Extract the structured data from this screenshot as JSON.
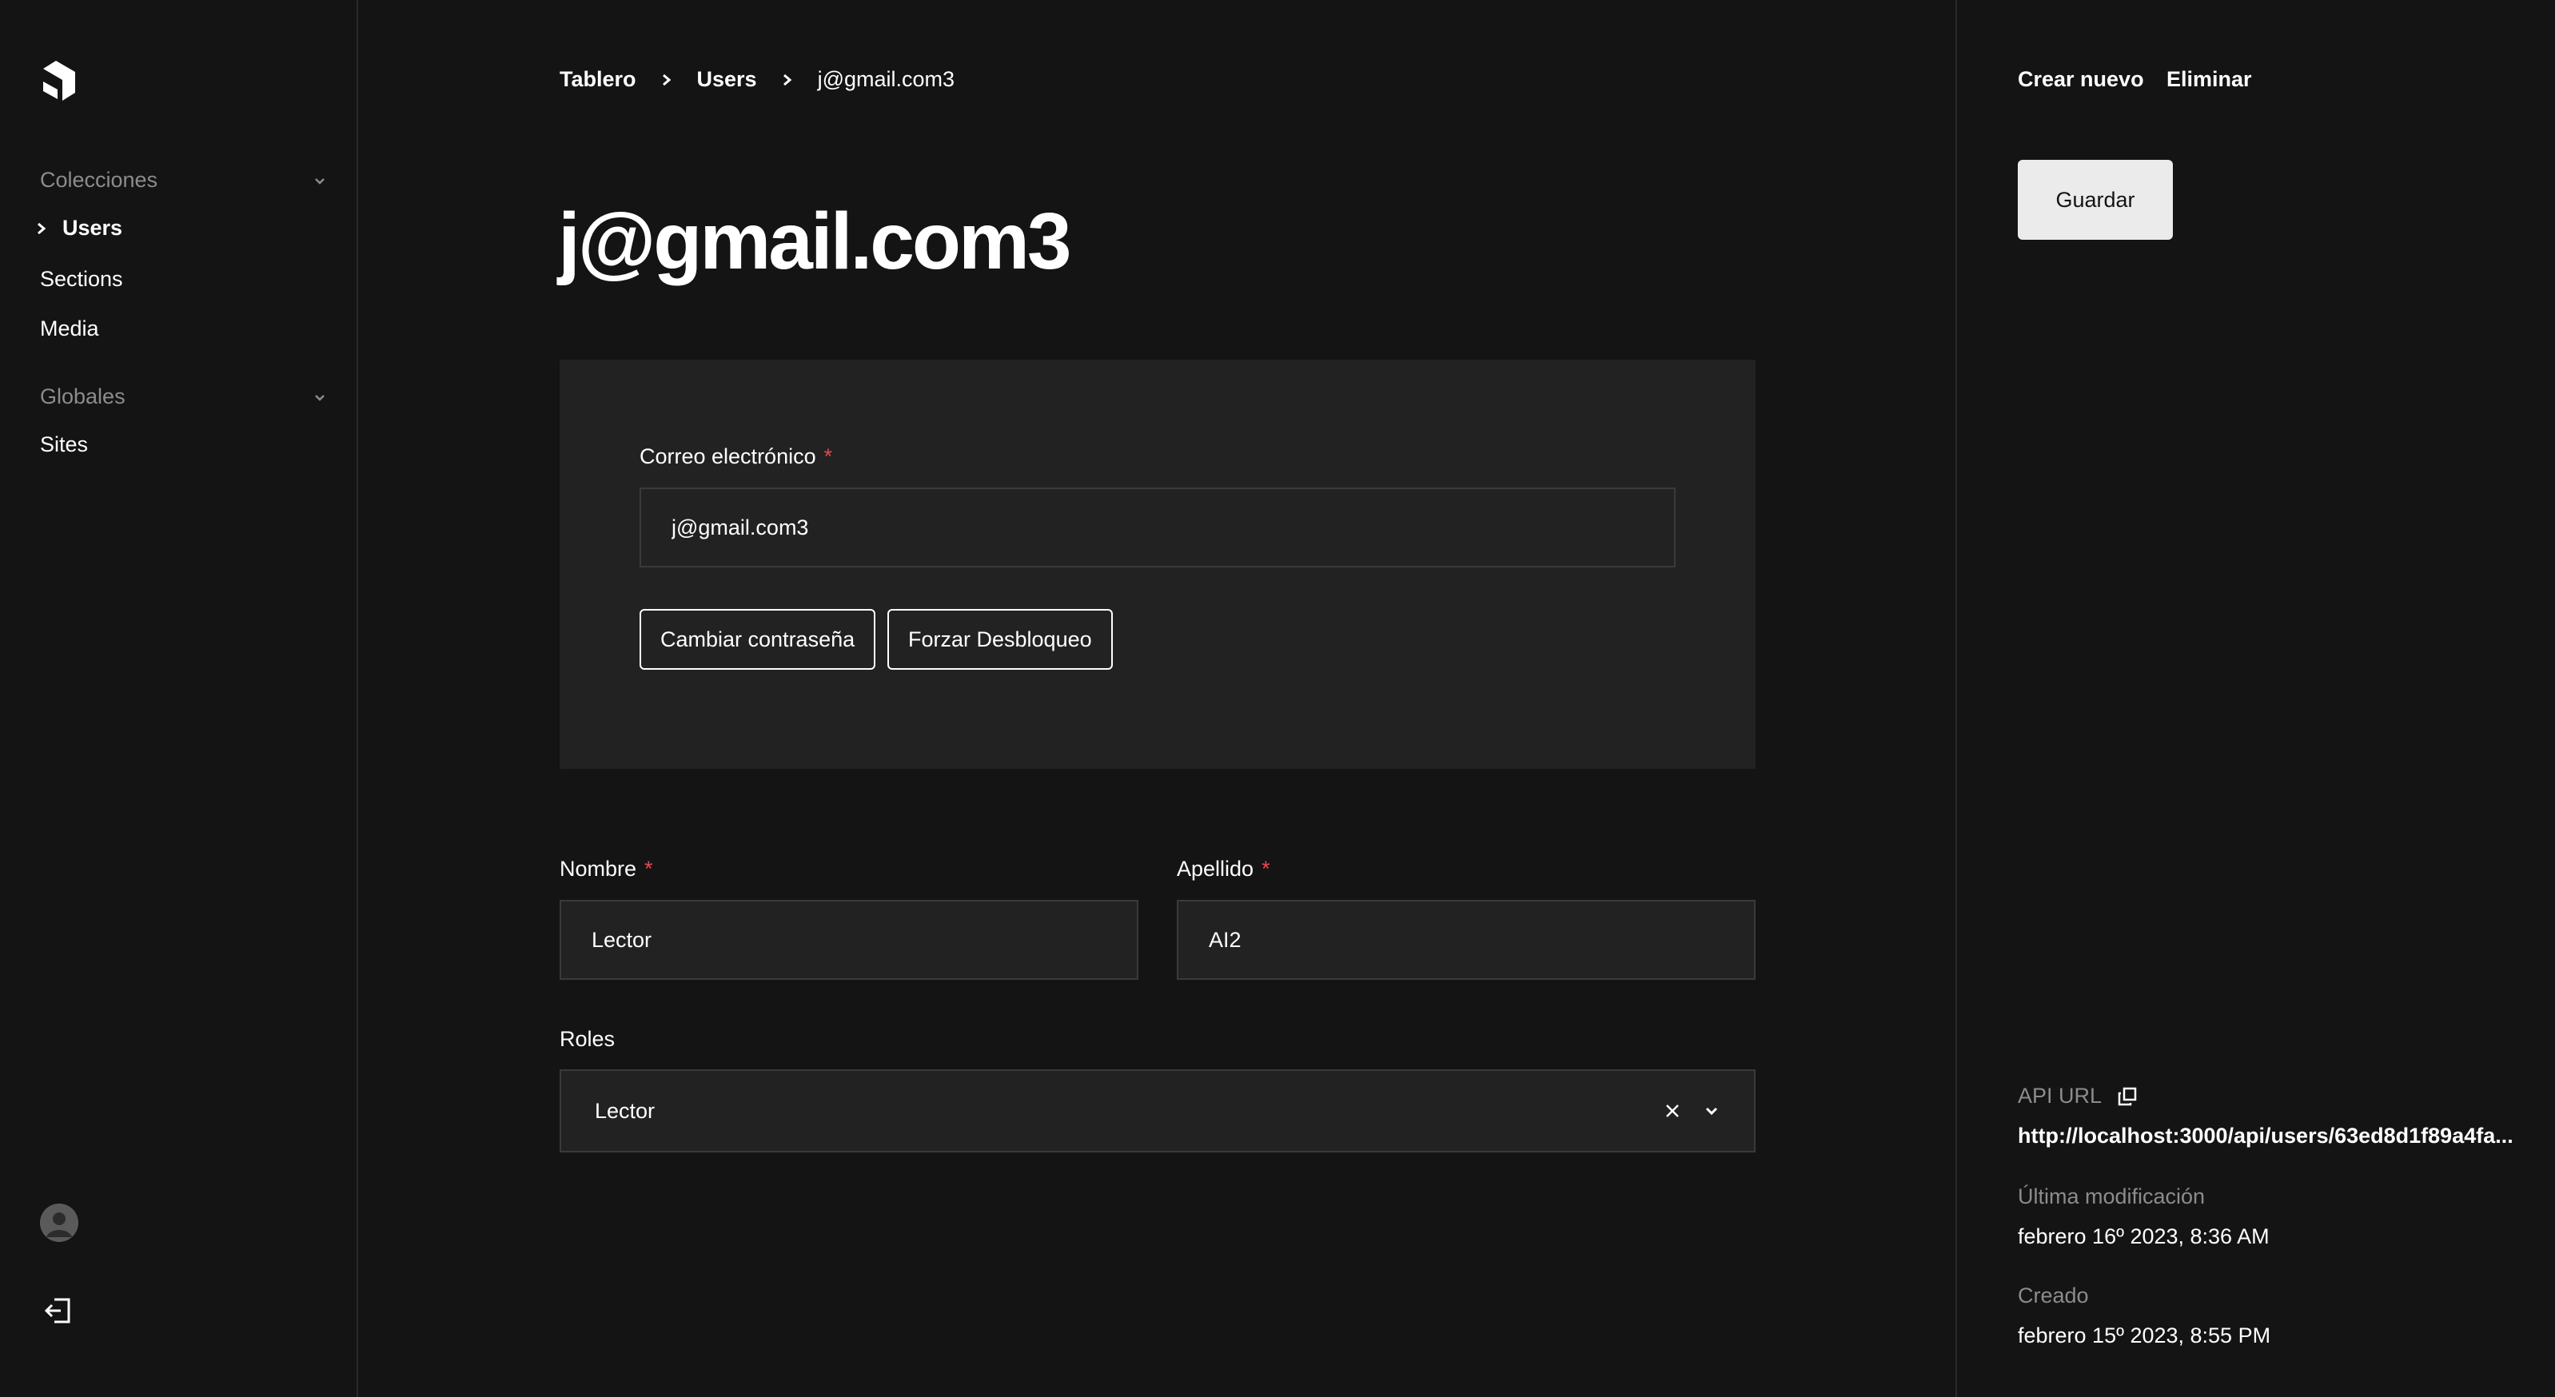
{
  "sidebar": {
    "groups": [
      {
        "label": "Colecciones",
        "items": [
          "Users",
          "Sections",
          "Media"
        ]
      },
      {
        "label": "Globales",
        "items": [
          "Sites"
        ]
      }
    ]
  },
  "breadcrumb": [
    "Tablero",
    "Users",
    "j@gmail.com3"
  ],
  "page_title": "j@gmail.com3",
  "form": {
    "email_label": "Correo electrónico",
    "email_value": "j@gmail.com3",
    "change_password_label": "Cambiar contraseña",
    "force_unlock_label": "Forzar Desbloqueo",
    "first_name_label": "Nombre",
    "first_name_value": "Lector",
    "last_name_label": "Apellido",
    "last_name_value": "AI2",
    "roles_label": "Roles",
    "roles_value": "Lector",
    "required_mark": "*"
  },
  "actions": {
    "create_new": "Crear nuevo",
    "delete": "Eliminar",
    "save": "Guardar"
  },
  "meta": {
    "api_url_label": "API URL",
    "api_url_value": "http://localhost:3000/api/users/63ed8d1f89a4fa...",
    "modified_label": "Última modificación",
    "modified_value": "febrero 16º 2023, 8:36 AM",
    "created_label": "Creado",
    "created_value": "febrero 15º 2023, 8:55 PM"
  },
  "icons": {
    "logo": "payload-logo-icon",
    "group_toggle": "chevron-down-icon",
    "active_caret": "chevron-right-icon",
    "breadcrumb_separator": "chevron-right-icon",
    "clear": "close-icon",
    "dropdown": "chevron-down-icon",
    "copy": "copy-icon",
    "avatar": "user-avatar-icon",
    "logout": "logout-icon"
  },
  "colors": {
    "background": "#141414",
    "card": "#222222",
    "required": "#e8474b",
    "save_button": "#ebebeb"
  }
}
